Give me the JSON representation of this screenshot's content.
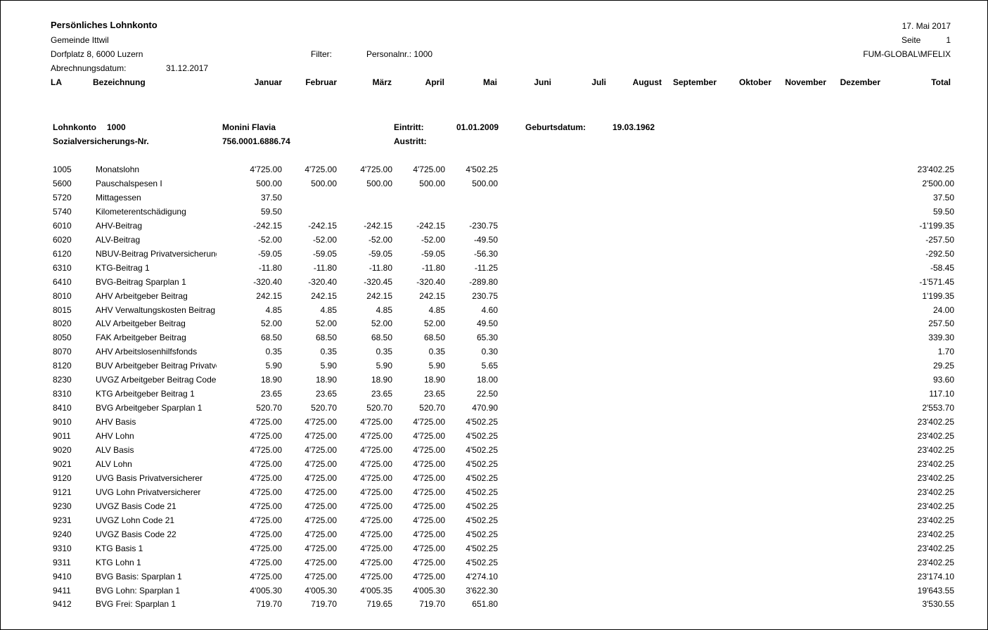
{
  "report": {
    "title": "Persönliches Lohnkonto",
    "company": "Gemeinde Ittwil",
    "address": "Dorfplatz 8, 6000 Luzern",
    "date": "17. Mai 2017",
    "page_label": "Seite",
    "page_number": "1",
    "filter_label": "Filter:",
    "filter_value": "Personalnr.: 1000",
    "user": "FUM-GLOBAL\\MFELIX",
    "billing_label": "Abrechnungsdatum:",
    "billing_date": "31.12.2017"
  },
  "columns": {
    "la": "LA",
    "bezeichnung": "Bezeichnung",
    "months": [
      "Januar",
      "Februar",
      "März",
      "April",
      "Mai",
      "Juni",
      "Juli",
      "August",
      "September",
      "Oktober",
      "November",
      "Dezember"
    ],
    "total": "Total"
  },
  "employee": {
    "account_label": "Lohnkonto",
    "account_number": "1000",
    "name": "Monini Flavia",
    "entry_label": "Eintritt:",
    "entry_date": "01.01.2009",
    "birth_label": "Geburtsdatum:",
    "birth_date": "19.03.1962",
    "ssn_label": "Sozialversicherungs-Nr.",
    "ssn": "756.0001.6886.74",
    "exit_label": "Austritt:"
  },
  "rows": [
    {
      "la": "1005",
      "desc": "Monatslohn",
      "v": [
        "4'725.00",
        "4'725.00",
        "4'725.00",
        "4'725.00",
        "4'502.25"
      ],
      "total": "23'402.25"
    },
    {
      "la": "5600",
      "desc": "Pauschalspesen I",
      "v": [
        "500.00",
        "500.00",
        "500.00",
        "500.00",
        "500.00"
      ],
      "total": "2'500.00"
    },
    {
      "la": "5720",
      "desc": "Mittagessen",
      "v": [
        "37.50",
        "",
        "",
        "",
        ""
      ],
      "total": "37.50"
    },
    {
      "la": "5740",
      "desc": "Kilometerentschädigung",
      "v": [
        "59.50",
        "",
        "",
        "",
        ""
      ],
      "total": "59.50"
    },
    {
      "la": "6010",
      "desc": "AHV-Beitrag",
      "v": [
        "-242.15",
        "-242.15",
        "-242.15",
        "-242.15",
        "-230.75"
      ],
      "total": "-1'199.35"
    },
    {
      "la": "6020",
      "desc": "ALV-Beitrag",
      "v": [
        "-52.00",
        "-52.00",
        "-52.00",
        "-52.00",
        "-49.50"
      ],
      "total": "-257.50"
    },
    {
      "la": "6120",
      "desc": "NBUV-Beitrag Privatversicherung",
      "v": [
        "-59.05",
        "-59.05",
        "-59.05",
        "-59.05",
        "-56.30"
      ],
      "total": "-292.50"
    },
    {
      "la": "6310",
      "desc": "KTG-Beitrag 1",
      "v": [
        "-11.80",
        "-11.80",
        "-11.80",
        "-11.80",
        "-11.25"
      ],
      "total": "-58.45"
    },
    {
      "la": "6410",
      "desc": "BVG-Beitrag Sparplan 1",
      "v": [
        "-320.40",
        "-320.40",
        "-320.45",
        "-320.40",
        "-289.80"
      ],
      "total": "-1'571.45"
    },
    {
      "la": "8010",
      "desc": "AHV Arbeitgeber Beitrag",
      "v": [
        "242.15",
        "242.15",
        "242.15",
        "242.15",
        "230.75"
      ],
      "total": "1'199.35"
    },
    {
      "la": "8015",
      "desc": "AHV Verwaltungskosten Beitrag",
      "v": [
        "4.85",
        "4.85",
        "4.85",
        "4.85",
        "4.60"
      ],
      "total": "24.00"
    },
    {
      "la": "8020",
      "desc": "ALV Arbeitgeber Beitrag",
      "v": [
        "52.00",
        "52.00",
        "52.00",
        "52.00",
        "49.50"
      ],
      "total": "257.50"
    },
    {
      "la": "8050",
      "desc": "FAK Arbeitgeber Beitrag",
      "v": [
        "68.50",
        "68.50",
        "68.50",
        "68.50",
        "65.30"
      ],
      "total": "339.30"
    },
    {
      "la": "8070",
      "desc": "AHV Arbeitslosenhilfsfonds",
      "v": [
        "0.35",
        "0.35",
        "0.35",
        "0.35",
        "0.30"
      ],
      "total": "1.70"
    },
    {
      "la": "8120",
      "desc": "BUV Arbeitgeber Beitrag Privatver",
      "v": [
        "5.90",
        "5.90",
        "5.90",
        "5.90",
        "5.65"
      ],
      "total": "29.25"
    },
    {
      "la": "8230",
      "desc": "UVGZ Arbeitgeber Beitrag Code",
      "v": [
        "18.90",
        "18.90",
        "18.90",
        "18.90",
        "18.00"
      ],
      "total": "93.60"
    },
    {
      "la": "8310",
      "desc": "KTG Arbeitgeber Beitrag 1",
      "v": [
        "23.65",
        "23.65",
        "23.65",
        "23.65",
        "22.50"
      ],
      "total": "117.10"
    },
    {
      "la": "8410",
      "desc": "BVG Arbeitgeber Sparplan 1",
      "v": [
        "520.70",
        "520.70",
        "520.70",
        "520.70",
        "470.90"
      ],
      "total": "2'553.70"
    },
    {
      "la": "9010",
      "desc": "AHV Basis",
      "v": [
        "4'725.00",
        "4'725.00",
        "4'725.00",
        "4'725.00",
        "4'502.25"
      ],
      "total": "23'402.25"
    },
    {
      "la": "9011",
      "desc": "AHV Lohn",
      "v": [
        "4'725.00",
        "4'725.00",
        "4'725.00",
        "4'725.00",
        "4'502.25"
      ],
      "total": "23'402.25"
    },
    {
      "la": "9020",
      "desc": "ALV Basis",
      "v": [
        "4'725.00",
        "4'725.00",
        "4'725.00",
        "4'725.00",
        "4'502.25"
      ],
      "total": "23'402.25"
    },
    {
      "la": "9021",
      "desc": "ALV Lohn",
      "v": [
        "4'725.00",
        "4'725.00",
        "4'725.00",
        "4'725.00",
        "4'502.25"
      ],
      "total": "23'402.25"
    },
    {
      "la": "9120",
      "desc": "UVG Basis Privatversicherer",
      "v": [
        "4'725.00",
        "4'725.00",
        "4'725.00",
        "4'725.00",
        "4'502.25"
      ],
      "total": "23'402.25"
    },
    {
      "la": "9121",
      "desc": "UVG Lohn Privatversicherer",
      "v": [
        "4'725.00",
        "4'725.00",
        "4'725.00",
        "4'725.00",
        "4'502.25"
      ],
      "total": "23'402.25"
    },
    {
      "la": "9230",
      "desc": "UVGZ Basis Code 21",
      "v": [
        "4'725.00",
        "4'725.00",
        "4'725.00",
        "4'725.00",
        "4'502.25"
      ],
      "total": "23'402.25"
    },
    {
      "la": "9231",
      "desc": "UVGZ Lohn Code 21",
      "v": [
        "4'725.00",
        "4'725.00",
        "4'725.00",
        "4'725.00",
        "4'502.25"
      ],
      "total": "23'402.25"
    },
    {
      "la": "9240",
      "desc": "UVGZ Basis Code 22",
      "v": [
        "4'725.00",
        "4'725.00",
        "4'725.00",
        "4'725.00",
        "4'502.25"
      ],
      "total": "23'402.25"
    },
    {
      "la": "9310",
      "desc": "KTG Basis 1",
      "v": [
        "4'725.00",
        "4'725.00",
        "4'725.00",
        "4'725.00",
        "4'502.25"
      ],
      "total": "23'402.25"
    },
    {
      "la": "9311",
      "desc": "KTG Lohn 1",
      "v": [
        "4'725.00",
        "4'725.00",
        "4'725.00",
        "4'725.00",
        "4'502.25"
      ],
      "total": "23'402.25"
    },
    {
      "la": "9410",
      "desc": "BVG Basis: Sparplan 1",
      "v": [
        "4'725.00",
        "4'725.00",
        "4'725.00",
        "4'725.00",
        "4'274.10"
      ],
      "total": "23'174.10"
    },
    {
      "la": "9411",
      "desc": "BVG Lohn: Sparplan 1",
      "v": [
        "4'005.30",
        "4'005.30",
        "4'005.35",
        "4'005.30",
        "3'622.30"
      ],
      "total": "19'643.55"
    },
    {
      "la": "9412",
      "desc": "BVG Frei: Sparplan 1",
      "v": [
        "719.70",
        "719.70",
        "719.65",
        "719.70",
        "651.80"
      ],
      "total": "3'530.55"
    }
  ]
}
